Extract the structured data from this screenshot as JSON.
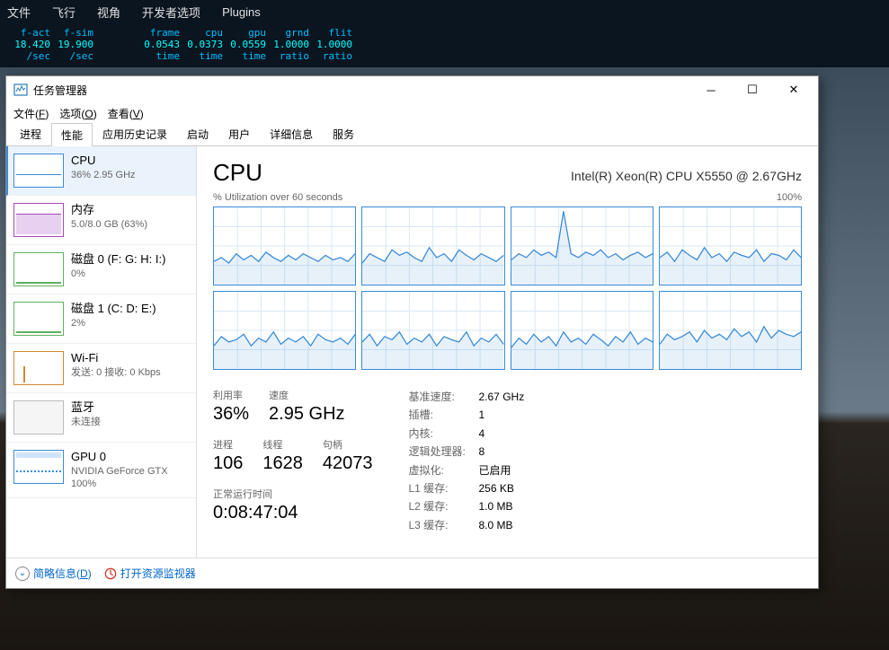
{
  "sim": {
    "menu": [
      "文件",
      "飞行",
      "视角",
      "开发者选项",
      "Plugins"
    ],
    "stats_hdr": [
      "f-act",
      "f-sim",
      "",
      "frame",
      "cpu",
      "gpu",
      "grnd",
      "flit"
    ],
    "stats_val": [
      "18.420",
      "19.900",
      "",
      "0.0543",
      "0.0373",
      "0.0559",
      "1.0000",
      "1.0000"
    ],
    "stats_sub": [
      "/sec",
      "/sec",
      "",
      "time",
      "time",
      "time",
      "ratio",
      "ratio"
    ]
  },
  "tm": {
    "title": "任务管理器",
    "menus": [
      {
        "label": "文件",
        "key": "F"
      },
      {
        "label": "选项",
        "key": "O"
      },
      {
        "label": "查看",
        "key": "V"
      }
    ],
    "tabs": [
      "进程",
      "性能",
      "应用历史记录",
      "启动",
      "用户",
      "详细信息",
      "服务"
    ],
    "active_tab": 1,
    "sidebar": [
      {
        "name": "CPU",
        "sub": "36% 2.95 GHz"
      },
      {
        "name": "内存",
        "sub": "5.0/8.0 GB (63%)"
      },
      {
        "name": "磁盘 0 (F: G: H: I:)",
        "sub": "0%"
      },
      {
        "name": "磁盘 1 (C: D: E:)",
        "sub": "2%"
      },
      {
        "name": "Wi-Fi",
        "sub": "发送: 0 接收: 0 Kbps"
      },
      {
        "name": "蓝牙",
        "sub": "未连接"
      },
      {
        "name": "GPU 0",
        "sub": "NVIDIA GeForce GTX",
        "sub2": "100%"
      }
    ],
    "main": {
      "title": "CPU",
      "model": "Intel(R) Xeon(R) CPU X5550 @ 2.67GHz",
      "chart_left": "% Utilization over 60 seconds",
      "chart_right": "100%",
      "metrics_top": [
        {
          "lbl": "利用率",
          "val": "36%"
        },
        {
          "lbl": "速度",
          "val": "2.95 GHz"
        }
      ],
      "metrics_bottom": [
        {
          "lbl": "进程",
          "val": "106"
        },
        {
          "lbl": "线程",
          "val": "1628"
        },
        {
          "lbl": "句柄",
          "val": "42073"
        }
      ],
      "uptime_lbl": "正常运行时间",
      "uptime_val": "0:08:47:04",
      "specs": [
        {
          "k": "基准速度:",
          "v": "2.67 GHz"
        },
        {
          "k": "插槽:",
          "v": "1"
        },
        {
          "k": "内核:",
          "v": "4"
        },
        {
          "k": "逻辑处理器:",
          "v": "8"
        },
        {
          "k": "虚拟化:",
          "v": "已启用"
        },
        {
          "k": "L1 缓存:",
          "v": "256 KB"
        },
        {
          "k": "L2 缓存:",
          "v": "1.0 MB"
        },
        {
          "k": "L3 缓存:",
          "v": "8.0 MB"
        }
      ]
    },
    "footer": {
      "brief": "简略信息",
      "brief_key": "D",
      "resmon": "打开资源监视器"
    }
  },
  "chart_data": {
    "type": "line",
    "title": "CPU % Utilization over 60 seconds",
    "xlabel": "seconds",
    "ylabel": "%",
    "ylim": [
      0,
      100
    ],
    "note": "8 logical processors shown as 8 small panels, ~30-45% baseline with jitter; core 2 shows one spike near 100%",
    "series": [
      {
        "name": "core0",
        "values": [
          30,
          35,
          28,
          40,
          32,
          38,
          30,
          42,
          35,
          30,
          38,
          32,
          40,
          35,
          30,
          38,
          32,
          35,
          30,
          40
        ]
      },
      {
        "name": "core1",
        "values": [
          28,
          40,
          35,
          30,
          45,
          38,
          42,
          35,
          30,
          48,
          35,
          40,
          30,
          45,
          38,
          32,
          40,
          35,
          30,
          38
        ]
      },
      {
        "name": "core2",
        "values": [
          32,
          40,
          35,
          45,
          38,
          42,
          35,
          95,
          40,
          35,
          42,
          38,
          45,
          35,
          40,
          32,
          38,
          42,
          35,
          40
        ]
      },
      {
        "name": "core3",
        "values": [
          35,
          42,
          30,
          45,
          38,
          32,
          48,
          35,
          40,
          30,
          42,
          38,
          35,
          45,
          30,
          40,
          38,
          32,
          45,
          35
        ]
      },
      {
        "name": "core4",
        "values": [
          30,
          42,
          35,
          38,
          45,
          30,
          40,
          35,
          48,
          32,
          40,
          35,
          42,
          30,
          45,
          38,
          35,
          40,
          32,
          45
        ]
      },
      {
        "name": "core5",
        "values": [
          35,
          45,
          30,
          42,
          38,
          48,
          32,
          40,
          35,
          45,
          30,
          42,
          38,
          35,
          48,
          30,
          40,
          35,
          45,
          32
        ]
      },
      {
        "name": "core6",
        "values": [
          28,
          40,
          32,
          45,
          35,
          42,
          30,
          48,
          35,
          40,
          32,
          45,
          38,
          30,
          42,
          35,
          48,
          32,
          40,
          35
        ]
      },
      {
        "name": "core7",
        "values": [
          32,
          45,
          38,
          42,
          48,
          35,
          50,
          40,
          45,
          38,
          52,
          42,
          48,
          35,
          55,
          40,
          50,
          45,
          42,
          48
        ]
      }
    ]
  }
}
